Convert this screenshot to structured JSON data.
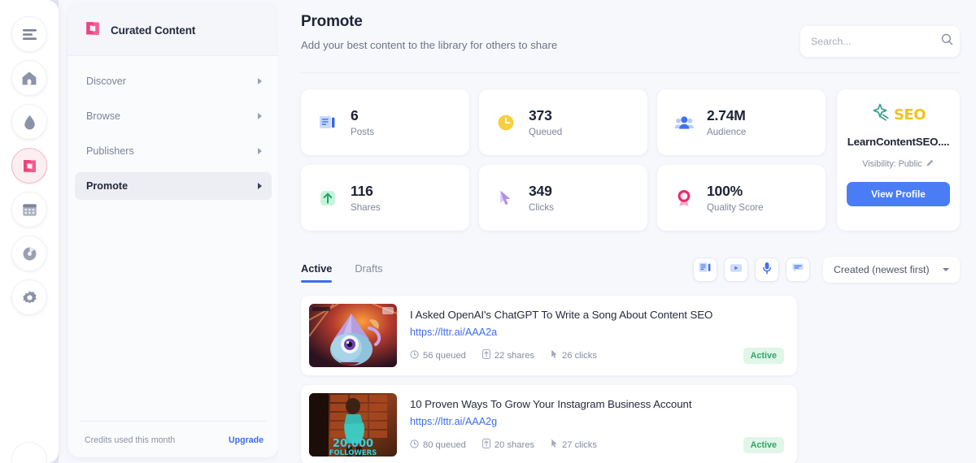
{
  "rail": {
    "items": [
      {
        "name": "menu",
        "icon": "hamburger-icon",
        "active": false
      },
      {
        "name": "home",
        "icon": "home-icon",
        "active": false
      },
      {
        "name": "water-drop",
        "icon": "drop-icon",
        "active": false
      },
      {
        "name": "curated-content",
        "icon": "lettr-logo-icon",
        "active": true
      },
      {
        "name": "calendar",
        "icon": "calendar-icon",
        "active": false
      },
      {
        "name": "analytics",
        "icon": "pie-chart-icon",
        "active": false
      },
      {
        "name": "settings",
        "icon": "gear-icon",
        "active": false
      }
    ]
  },
  "panel": {
    "brand": "Curated Content",
    "nav": [
      {
        "label": "Discover",
        "active": false
      },
      {
        "label": "Browse",
        "active": false
      },
      {
        "label": "Publishers",
        "active": false
      },
      {
        "label": "Promote",
        "active": true
      }
    ],
    "credits_label": "Credits used this month",
    "upgrade_label": "Upgrade"
  },
  "header": {
    "title": "Promote",
    "subtitle": "Add your best content to the library for others to share",
    "search_placeholder": "Search...",
    "search_value": ""
  },
  "stats": [
    {
      "value": "6",
      "label": "Posts",
      "icon": "article-icon",
      "color": "#4a7df5"
    },
    {
      "value": "373",
      "label": "Queued",
      "icon": "clock-icon",
      "color": "#f5ce3e"
    },
    {
      "value": "2.74M",
      "label": "Audience",
      "icon": "people-icon",
      "color": "#4a7df5"
    },
    {
      "value": "116",
      "label": "Shares",
      "icon": "share-up-arrow-icon",
      "color": "#35c07c"
    },
    {
      "value": "349",
      "label": "Clicks",
      "icon": "cursor-icon",
      "color": "#a46cf0"
    },
    {
      "value": "100%",
      "label": "Quality Score",
      "icon": "ribbon-award-icon",
      "color": "#ec2a6b"
    }
  ],
  "profile": {
    "logo_word": "SEO",
    "logo_icon": "seo-sparkle-icon",
    "name": "LearnContentSEO....",
    "visibility": "Visibility: Public",
    "visibility_icon": "edit-pencil-icon",
    "button_label": "View Profile",
    "button_color": "#4a7df5"
  },
  "tabs": [
    {
      "label": "Active",
      "active": true
    },
    {
      "label": "Drafts",
      "active": false
    }
  ],
  "tools": [
    {
      "name": "filter-article",
      "icon": "article-filter-icon"
    },
    {
      "name": "filter-video",
      "icon": "video-play-icon"
    },
    {
      "name": "filter-audio",
      "icon": "microphone-icon"
    },
    {
      "name": "filter-quote",
      "icon": "quote-caption-icon"
    }
  ],
  "sort": {
    "label": "Created (newest first)",
    "options": [
      "Created (newest first)"
    ]
  },
  "list": [
    {
      "title": "I Asked OpenAI's ChatGPT To Write a Song About Content SEO",
      "url": "https://lttr.ai/AAA2a",
      "queued": "56 queued",
      "shares": "22 shares",
      "clicks": "26 clicks",
      "status": "Active",
      "thumb_kind": "alien-monster",
      "thumb_caption": ""
    },
    {
      "title": "10 Proven Ways To Grow Your Instagram Business Account",
      "url": "https://lttr.ai/AAA2g",
      "queued": "80 queued",
      "shares": "20 shares",
      "clicks": "27 clicks",
      "status": "Active",
      "thumb_kind": "instagram-followers",
      "thumb_caption": "20,000",
      "thumb_caption2": "FOLLOWERS"
    }
  ]
}
